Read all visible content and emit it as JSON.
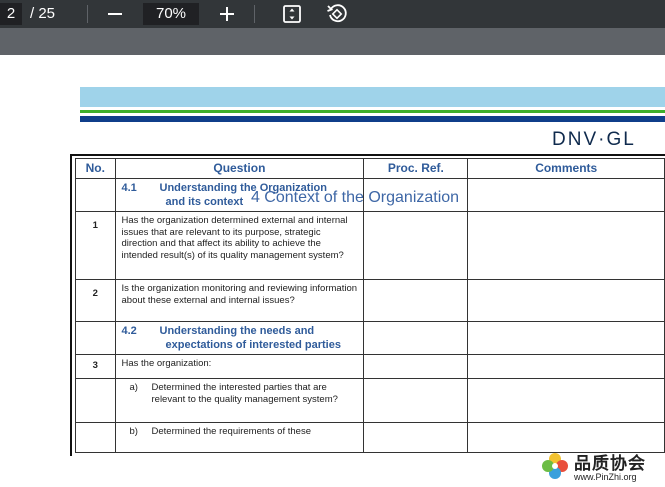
{
  "toolbar": {
    "page_current": "2",
    "page_total": "/ 25",
    "zoom": "70%",
    "icons": {
      "zoom_out": "minus-icon",
      "zoom_in": "plus-icon",
      "fit": "fit-page-icon",
      "rotate": "rotate-icon"
    }
  },
  "document": {
    "logo_text": "DNV·GL",
    "section_title": "4 Context of the Organization",
    "table": {
      "headers": [
        "No.",
        "Question",
        "Proc. Ref.",
        "Comments"
      ],
      "rows": [
        {
          "no": "",
          "heading_num": "4.1",
          "heading_line1": "Understanding the Organization",
          "heading_line2": "and its context"
        },
        {
          "no": "1",
          "text": "Has the organization determined external and internal issues that are relevant to its purpose, strategic direction and that affect its ability to achieve the intended result(s)  of its quality management system?"
        },
        {
          "no": "2",
          "text": "Is the organization monitoring and reviewing information about these external and internal issues?"
        },
        {
          "no": "",
          "heading_num": "4.2",
          "heading_line1": "Understanding the needs and",
          "heading_line2": "expectations of interested parties"
        },
        {
          "no": "3",
          "text": "Has the organization:"
        },
        {
          "no": "",
          "letter": "a)",
          "text": "Determined the interested parties that are relevant to the quality management system?"
        },
        {
          "no": "",
          "letter": "b)",
          "text": "Determined the requirements of these"
        }
      ]
    }
  },
  "watermark": {
    "text_cn": "品质协会",
    "url": "www.PinZhi.org"
  },
  "colors": {
    "toolbar_bg": "#323639",
    "heading_blue": "#2f5b9a",
    "band_light_blue": "#9fd3ea",
    "band_green": "#3dae2b",
    "band_dark_blue": "#0f3e8a"
  }
}
